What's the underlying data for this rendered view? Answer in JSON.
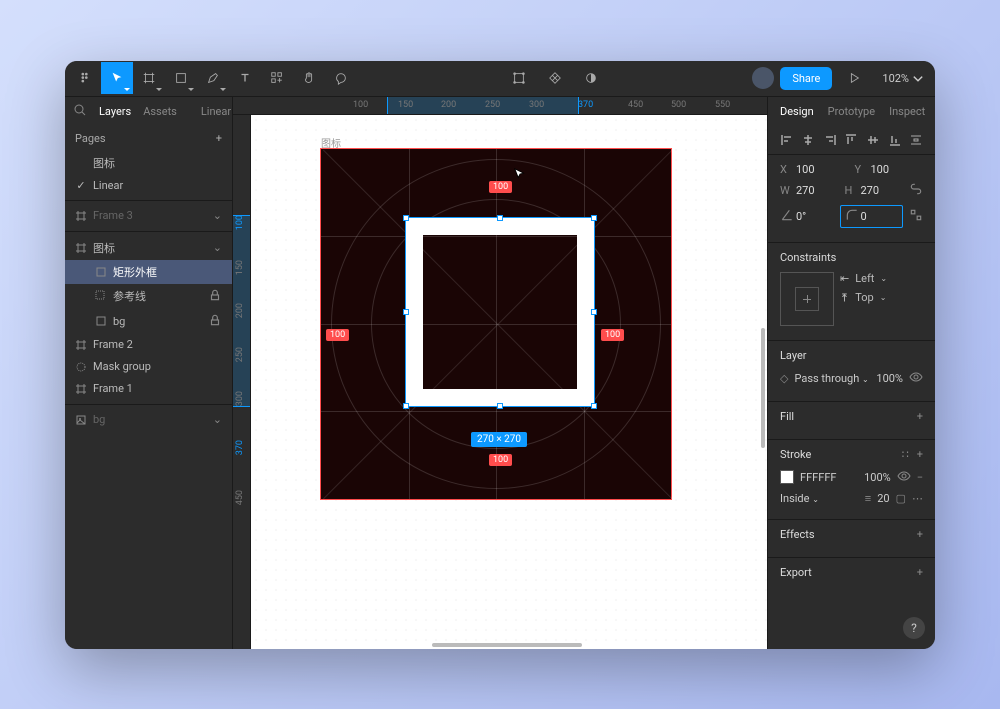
{
  "toolbar": {
    "share_label": "Share",
    "zoom": "102%"
  },
  "left_panel": {
    "tabs": {
      "layers": "Layers",
      "assets": "Assets",
      "mode": "Linear"
    },
    "pages_header": "Pages",
    "pages": [
      {
        "name": "图标",
        "checked": false
      },
      {
        "name": "Linear",
        "checked": true
      }
    ],
    "layers": [
      {
        "name": "Frame 3",
        "type": "frame",
        "depth": 0,
        "dim": true,
        "trail": "chev"
      },
      {
        "name": "图标",
        "type": "frame",
        "depth": 0,
        "expanded": true,
        "trail": "chev"
      },
      {
        "name": "矩形外框",
        "type": "rect",
        "depth": 1,
        "selected": true
      },
      {
        "name": "参考线",
        "type": "group",
        "depth": 1,
        "trail": "lock"
      },
      {
        "name": "bg",
        "type": "rect",
        "depth": 1,
        "trail": "lock"
      },
      {
        "name": "Frame 2",
        "type": "frame",
        "depth": 0
      },
      {
        "name": "Mask group",
        "type": "mask",
        "depth": 0
      },
      {
        "name": "Frame 1",
        "type": "frame",
        "depth": 0
      },
      {
        "name": "bg",
        "type": "image",
        "depth": 0,
        "dim": true,
        "trail": "chev"
      }
    ]
  },
  "canvas": {
    "ruler_h": [
      "100",
      "150",
      "200",
      "250",
      "300",
      "370",
      "450",
      "500",
      "550"
    ],
    "ruler_v": [
      "100",
      "150",
      "200",
      "250",
      "300",
      "370",
      "450"
    ],
    "artboard_label": "图标",
    "dist_top": "100",
    "dist_bottom": "100",
    "dist_left": "100",
    "dist_right": "100",
    "dimensions": "270 × 270"
  },
  "right_panel": {
    "tabs": {
      "design": "Design",
      "prototype": "Prototype",
      "inspect": "Inspect"
    },
    "x": {
      "label": "X",
      "value": "100"
    },
    "y": {
      "label": "Y",
      "value": "100"
    },
    "w": {
      "label": "W",
      "value": "270"
    },
    "h": {
      "label": "H",
      "value": "270"
    },
    "rotation": {
      "label": "0°"
    },
    "radius": {
      "value": "0"
    },
    "constraints": {
      "header": "Constraints",
      "horizontal": "Left",
      "vertical": "Top"
    },
    "layer_section": {
      "header": "Layer",
      "blend": "Pass through",
      "opacity": "100%"
    },
    "fill": {
      "header": "Fill"
    },
    "stroke": {
      "header": "Stroke",
      "color": "FFFFFF",
      "opacity": "100%",
      "position": "Inside",
      "width": "20"
    },
    "effects": {
      "header": "Effects"
    },
    "export": {
      "header": "Export"
    }
  },
  "help": "?"
}
